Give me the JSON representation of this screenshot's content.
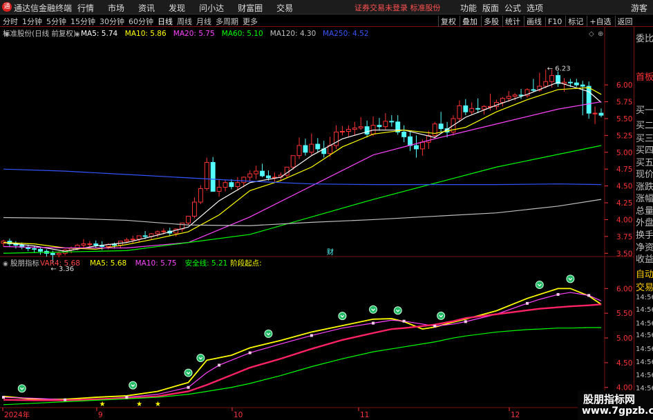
{
  "window": {
    "title": "通达信金融终端",
    "icon_text": "通"
  },
  "menu": [
    "行情",
    "市场",
    "资讯",
    "发现",
    "问小达",
    "财富圈",
    "交易"
  ],
  "notice": "证券交易未登录  标准股份",
  "tools": [
    "功能",
    "版面",
    "公式",
    "选项"
  ],
  "guest": "游客",
  "periods": {
    "items": [
      "分时",
      "1分钟",
      "5分钟",
      "15分钟",
      "30分钟",
      "60分钟",
      "日线",
      "周线",
      "月线",
      "多周期",
      "更多"
    ],
    "active": "日线"
  },
  "right_buttons": [
    "复权",
    "叠加",
    "多股",
    "统计",
    "画线",
    "F10",
    "标记",
    "+自选",
    "返回"
  ],
  "main_header": {
    "stock": "标准股份(日线 前复权)",
    "indicators": [
      {
        "label": "MA5: 5.74",
        "color": "#ffffff"
      },
      {
        "label": "MA10: 5.86",
        "color": "#ffff00"
      },
      {
        "label": "MA20: 5.75",
        "color": "#ff44ff"
      },
      {
        "label": "MA60: 5.10",
        "color": "#00ff00"
      },
      {
        "label": "MA120: 4.30",
        "color": "#c0c0c0"
      },
      {
        "label": "MA250: 4.52",
        "color": "#3355ff"
      }
    ]
  },
  "sub_header": {
    "name": "股朋指标",
    "indicators": [
      {
        "label": "VAR4: 5.68",
        "color": "#ff4444"
      },
      {
        "label": "MA5: 5.68",
        "color": "#ffff00"
      },
      {
        "label": "MA10: 5.75",
        "color": "#ff44ff"
      },
      {
        "label": "安全线: 5.21",
        "color": "#00ff00"
      },
      {
        "label": "阶段起点:",
        "color": "#ffff00"
      }
    ]
  },
  "y_axis_main": [
    "6.00",
    "5.75",
    "5.50",
    "5.25",
    "5.00",
    "4.75",
    "4.50",
    "4.25",
    "4.00",
    "3.75",
    "3.50"
  ],
  "y_axis_sub": [
    "6.00",
    "5.50",
    "5.00",
    "4.50",
    "4.00"
  ],
  "x_axis": [
    "2024年",
    "9",
    "10",
    "11",
    "12"
  ],
  "annotations": {
    "high": "6.23",
    "low": "3.36",
    "marker": "财"
  },
  "side_panel": [
    {
      "text": "委比",
      "color": "#c0c0c0"
    },
    {
      "text": "首板",
      "color": "#ff3030"
    },
    {
      "text": "买一",
      "color": "#c0c0c0"
    },
    {
      "text": "买二",
      "color": "#c0c0c0"
    },
    {
      "text": "买三",
      "color": "#c0c0c0"
    },
    {
      "text": "买四",
      "color": "#c0c0c0"
    },
    {
      "text": "买五",
      "color": "#c0c0c0"
    },
    {
      "text": "现价",
      "color": "#c0c0c0"
    },
    {
      "text": "涨跌",
      "color": "#c0c0c0"
    },
    {
      "text": "涨幅",
      "color": "#c0c0c0"
    },
    {
      "text": "总量",
      "color": "#c0c0c0"
    },
    {
      "text": "外盘",
      "color": "#c0c0c0"
    },
    {
      "text": "换手",
      "color": "#c0c0c0"
    },
    {
      "text": "净资",
      "color": "#c0c0c0"
    },
    {
      "text": "收益",
      "color": "#c0c0c0"
    },
    {
      "text": "自动",
      "color": "#ffcc00"
    },
    {
      "text": "交易",
      "color": "#ffcc00"
    },
    {
      "text": "14:56",
      "color": "#c0c0c0"
    },
    {
      "text": "14:56",
      "color": "#c0c0c0"
    },
    {
      "text": "14:56",
      "color": "#c0c0c0"
    },
    {
      "text": "14:56",
      "color": "#c0c0c0"
    },
    {
      "text": "14:56",
      "color": "#c0c0c0"
    },
    {
      "text": "14:56",
      "color": "#c0c0c0"
    },
    {
      "text": "14:56",
      "color": "#c0c0c0"
    },
    {
      "text": "14:56",
      "color": "#c0c0c0"
    },
    {
      "text": "14:56",
      "color": "#c0c0c0"
    }
  ],
  "watermark": {
    "line1": "股朋指标网",
    "line2": "www.7gpzb.com"
  },
  "chart_data": [
    {
      "type": "candlestick",
      "ylim": [
        3.38,
        6.38
      ],
      "series": [
        {
          "name": "K",
          "x": [
            0,
            1,
            2,
            3,
            4,
            5,
            6,
            7,
            8,
            9,
            10,
            11,
            12,
            13,
            14,
            15,
            16,
            17,
            18,
            19,
            20,
            21,
            22,
            23,
            24,
            25,
            26,
            27,
            28,
            29,
            30,
            31,
            32,
            33,
            34,
            35,
            36,
            37,
            38,
            39,
            40,
            41,
            42,
            43,
            44,
            45,
            46,
            47,
            48,
            49,
            50,
            51,
            52,
            53,
            54,
            55,
            56,
            57,
            58,
            59,
            60,
            61,
            62,
            63,
            64,
            65,
            66,
            67,
            68,
            69,
            70,
            71,
            72,
            73,
            74,
            75,
            76,
            77,
            78,
            79,
            80,
            81,
            82,
            83,
            84,
            85,
            86,
            87,
            88,
            89,
            90,
            91,
            92,
            93,
            94,
            95,
            96,
            97
          ],
          "open": [
            3.65,
            3.68,
            3.64,
            3.62,
            3.59,
            3.57,
            3.56,
            3.53,
            3.5,
            3.48,
            3.5,
            3.55,
            3.58,
            3.62,
            3.64,
            3.64,
            3.62,
            3.6,
            3.63,
            3.62,
            3.68,
            3.7,
            3.71,
            3.76,
            3.75,
            3.79,
            3.82,
            3.83,
            3.8,
            3.86,
            3.95,
            4.05,
            4.26,
            4.46,
            4.85,
            4.42,
            4.48,
            4.55,
            4.49,
            4.55,
            4.63,
            4.68,
            4.72,
            4.65,
            4.62,
            4.63,
            4.66,
            4.78,
            4.95,
            5.1,
            5.0,
            5.12,
            5.05,
            4.98,
            5.1,
            5.3,
            5.31,
            5.34,
            5.36,
            5.38,
            5.27,
            5.4,
            5.38,
            5.46,
            5.45,
            5.3,
            5.23,
            5.1,
            5.05,
            5.15,
            5.25,
            5.42,
            5.35,
            5.3,
            5.5,
            5.69,
            5.6,
            5.65,
            5.64,
            5.68,
            5.68,
            5.74,
            5.8,
            5.83,
            5.85,
            5.84,
            5.93,
            5.92,
            5.98,
            6.05,
            6.14,
            6.02,
            6.04,
            6.03,
            6.0,
            5.98,
            5.58,
            5.58
          ],
          "high": [
            3.7,
            3.72,
            3.68,
            3.66,
            3.63,
            3.61,
            3.59,
            3.56,
            3.54,
            3.53,
            3.56,
            3.6,
            3.64,
            3.71,
            3.68,
            3.69,
            3.68,
            3.65,
            3.66,
            3.66,
            3.73,
            3.76,
            3.76,
            3.83,
            3.8,
            3.84,
            3.87,
            3.88,
            3.87,
            3.92,
            4.03,
            4.33,
            4.51,
            4.92,
            4.93,
            4.6,
            4.59,
            4.6,
            4.63,
            4.64,
            4.73,
            4.8,
            4.83,
            4.73,
            4.7,
            4.7,
            4.75,
            4.89,
            5.22,
            5.2,
            5.28,
            5.21,
            5.17,
            5.23,
            5.4,
            5.39,
            5.4,
            5.45,
            5.52,
            5.47,
            5.53,
            5.51,
            5.58,
            5.55,
            5.55,
            5.4,
            5.31,
            5.25,
            5.19,
            5.32,
            5.45,
            5.6,
            5.45,
            5.55,
            5.77,
            5.79,
            5.74,
            5.8,
            5.7,
            5.87,
            5.78,
            5.82,
            5.91,
            5.88,
            5.94,
            5.95,
            6.09,
            6.18,
            6.23,
            6.23,
            6.2,
            6.1,
            6.09,
            6.09,
            6.06,
            6.05,
            5.68,
            5.65
          ],
          "low": [
            3.6,
            3.6,
            3.57,
            3.56,
            3.53,
            3.51,
            3.48,
            3.45,
            3.36,
            3.44,
            3.47,
            3.5,
            3.54,
            3.58,
            3.58,
            3.58,
            3.55,
            3.56,
            3.57,
            3.57,
            3.65,
            3.65,
            3.66,
            3.71,
            3.71,
            3.74,
            3.78,
            3.76,
            3.75,
            3.82,
            3.92,
            4.02,
            4.23,
            4.43,
            4.48,
            4.34,
            4.42,
            4.45,
            4.43,
            4.48,
            4.57,
            4.6,
            4.63,
            4.58,
            4.56,
            4.57,
            4.62,
            4.74,
            4.9,
            4.95,
            4.95,
            5.0,
            4.92,
            4.93,
            5.05,
            5.25,
            5.22,
            5.25,
            5.33,
            5.22,
            5.24,
            5.32,
            5.32,
            5.38,
            5.26,
            5.15,
            5.02,
            4.92,
            4.95,
            5.05,
            5.2,
            5.3,
            5.22,
            5.25,
            5.45,
            5.55,
            5.55,
            5.58,
            5.56,
            5.62,
            5.63,
            5.68,
            5.75,
            5.77,
            5.79,
            5.81,
            5.9,
            5.9,
            5.95,
            5.96,
            5.97,
            5.9,
            5.97,
            5.97,
            5.55,
            5.5,
            5.42,
            5.52
          ],
          "close": [
            3.68,
            3.64,
            3.62,
            3.59,
            3.57,
            3.56,
            3.53,
            3.5,
            3.48,
            3.5,
            3.55,
            3.58,
            3.62,
            3.64,
            3.64,
            3.62,
            3.6,
            3.63,
            3.62,
            3.68,
            3.7,
            3.71,
            3.76,
            3.75,
            3.79,
            3.82,
            3.83,
            3.8,
            3.86,
            3.95,
            4.05,
            4.26,
            4.46,
            4.85,
            4.42,
            4.48,
            4.55,
            4.49,
            4.55,
            4.63,
            4.68,
            4.72,
            4.65,
            4.62,
            4.63,
            4.66,
            4.78,
            4.95,
            5.1,
            5.0,
            5.12,
            5.05,
            4.98,
            5.1,
            5.3,
            5.31,
            5.34,
            5.36,
            5.38,
            5.27,
            5.4,
            5.38,
            5.46,
            5.45,
            5.3,
            5.23,
            5.1,
            5.05,
            5.15,
            5.25,
            5.42,
            5.35,
            5.3,
            5.5,
            5.69,
            5.6,
            5.65,
            5.64,
            5.68,
            5.68,
            5.74,
            5.8,
            5.83,
            5.85,
            5.84,
            5.93,
            5.92,
            5.98,
            6.05,
            6.14,
            6.02,
            6.04,
            6.03,
            6.0,
            5.98,
            5.58,
            5.58,
            5.55
          ]
        }
      ],
      "ma": [
        {
          "name": "MA5",
          "color": "#ffffff",
          "x": [
            0,
            5,
            10,
            15,
            20,
            25,
            30,
            35,
            40,
            45,
            50,
            55,
            60,
            65,
            70,
            75,
            80,
            85,
            90,
            95,
            97
          ],
          "values": [
            3.66,
            3.61,
            3.53,
            3.61,
            3.66,
            3.77,
            3.89,
            4.28,
            4.55,
            4.63,
            4.95,
            5.2,
            5.33,
            5.33,
            5.22,
            5.52,
            5.7,
            5.86,
            6.04,
            5.9,
            5.74
          ]
        },
        {
          "name": "MA10",
          "color": "#ffff00",
          "x": [
            0,
            5,
            10,
            15,
            20,
            25,
            30,
            35,
            40,
            45,
            50,
            55,
            60,
            65,
            70,
            75,
            80,
            85,
            90,
            95,
            97
          ],
          "values": [
            3.66,
            3.64,
            3.58,
            3.56,
            3.63,
            3.72,
            3.82,
            4.07,
            4.43,
            4.58,
            4.78,
            5.08,
            5.27,
            5.33,
            5.28,
            5.37,
            5.6,
            5.78,
            5.93,
            5.96,
            5.86
          ]
        },
        {
          "name": "MA20",
          "color": "#ff44ff",
          "x": [
            0,
            10,
            20,
            30,
            40,
            50,
            60,
            70,
            80,
            90,
            97
          ],
          "values": [
            3.6,
            3.58,
            3.58,
            3.66,
            4.04,
            4.5,
            4.96,
            5.2,
            5.42,
            5.64,
            5.75
          ]
        },
        {
          "name": "MA60",
          "color": "#00ff00",
          "x": [
            0,
            20,
            40,
            60,
            80,
            97
          ],
          "values": [
            3.5,
            3.54,
            3.78,
            4.3,
            4.78,
            5.1
          ]
        },
        {
          "name": "MA120",
          "color": "#c0c0c0",
          "x": [
            0,
            10,
            20,
            30,
            40,
            50,
            60,
            70,
            80,
            90,
            97
          ],
          "values": [
            4.03,
            4.02,
            3.99,
            3.92,
            3.91,
            3.96,
            4.0,
            4.05,
            4.1,
            4.2,
            4.3
          ]
        },
        {
          "name": "MA250",
          "color": "#3355ff",
          "x": [
            0,
            10,
            20,
            30,
            40,
            50,
            60,
            70,
            80,
            90,
            97
          ],
          "values": [
            4.75,
            4.72,
            4.67,
            4.62,
            4.57,
            4.53,
            4.52,
            4.52,
            4.52,
            4.53,
            4.52
          ]
        }
      ]
    },
    {
      "type": "line",
      "ylim": [
        3.55,
        6.2
      ],
      "x": [
        0,
        5,
        10,
        15,
        20,
        25,
        30,
        33,
        35,
        37,
        40,
        45,
        50,
        55,
        60,
        63,
        65,
        68,
        70,
        73,
        75,
        80,
        85,
        87,
        90,
        92,
        95,
        97
      ],
      "series": [
        {
          "name": "MA5",
          "color": "#ffff00",
          "values": [
            3.82,
            3.76,
            3.76,
            3.8,
            3.83,
            3.92,
            4.1,
            4.55,
            4.6,
            4.65,
            4.8,
            4.95,
            5.12,
            5.25,
            5.38,
            5.39,
            5.33,
            5.18,
            5.22,
            5.32,
            5.38,
            5.55,
            5.8,
            5.88,
            6.0,
            6.0,
            5.85,
            5.68
          ]
        },
        {
          "name": "MA10",
          "color": "#ff44ff",
          "values": [
            3.8,
            3.78,
            3.75,
            3.76,
            3.8,
            3.86,
            4.0,
            4.3,
            4.45,
            4.55,
            4.7,
            4.88,
            5.05,
            5.2,
            5.3,
            5.36,
            5.34,
            5.28,
            5.24,
            5.28,
            5.33,
            5.48,
            5.7,
            5.78,
            5.88,
            5.92,
            5.86,
            5.75
          ]
        },
        {
          "name": "VAR4",
          "color": "#ff2266",
          "values": [
            3.75,
            3.74,
            3.74,
            3.76,
            3.78,
            3.82,
            3.92,
            4.05,
            4.15,
            4.25,
            4.4,
            4.58,
            4.78,
            4.96,
            5.1,
            5.18,
            5.2,
            5.24,
            5.27,
            5.34,
            5.4,
            5.48,
            5.56,
            5.59,
            5.62,
            5.64,
            5.66,
            5.68
          ]
        },
        {
          "name": "安全线",
          "color": "#00ff00",
          "values": [
            3.65,
            3.68,
            3.71,
            3.74,
            3.77,
            3.8,
            3.86,
            3.92,
            3.96,
            4.0,
            4.08,
            4.24,
            4.42,
            4.58,
            4.72,
            4.78,
            4.82,
            4.88,
            4.92,
            5.0,
            5.04,
            5.12,
            5.17,
            5.18,
            5.2,
            5.2,
            5.21,
            5.21
          ]
        }
      ],
      "green_markers_x": [
        3,
        21,
        30,
        32,
        43,
        55,
        60,
        64,
        71,
        87,
        92
      ],
      "star_markers_x": [
        16,
        22,
        25
      ]
    }
  ]
}
